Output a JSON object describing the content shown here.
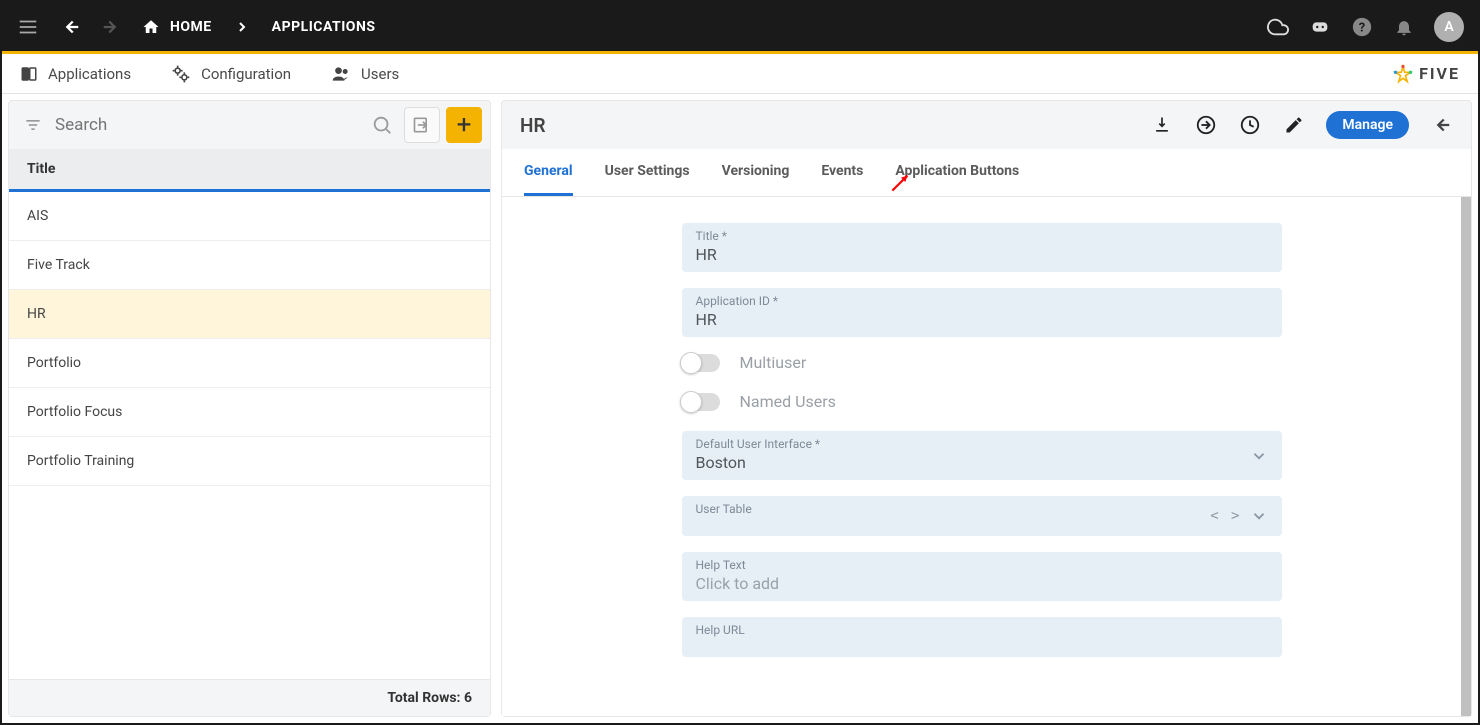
{
  "topbar": {
    "home": "HOME",
    "applications": "APPLICATIONS",
    "avatar": "A"
  },
  "navbar": {
    "items": [
      {
        "label": "Applications"
      },
      {
        "label": "Configuration"
      },
      {
        "label": "Users"
      }
    ],
    "brand": "FIVE"
  },
  "left": {
    "search_placeholder": "Search",
    "header": "Title",
    "rows": [
      {
        "title": "AIS"
      },
      {
        "title": "Five Track"
      },
      {
        "title": "HR",
        "selected": true
      },
      {
        "title": "Portfolio"
      },
      {
        "title": "Portfolio Focus"
      },
      {
        "title": "Portfolio Training"
      }
    ],
    "total_label": "Total Rows: 6"
  },
  "right": {
    "title": "HR",
    "manage": "Manage",
    "tabs": [
      "General",
      "User Settings",
      "Versioning",
      "Events",
      "Application Buttons"
    ],
    "active_tab": 0,
    "form": {
      "title_label": "Title *",
      "title_value": "HR",
      "appid_label": "Application ID *",
      "appid_value": "HR",
      "multiuser_label": "Multiuser",
      "namedusers_label": "Named Users",
      "dui_label": "Default User Interface *",
      "dui_value": "Boston",
      "usertable_label": "User Table",
      "helptext_label": "Help Text",
      "helptext_placeholder": "Click to add",
      "helpurl_label": "Help URL"
    }
  }
}
